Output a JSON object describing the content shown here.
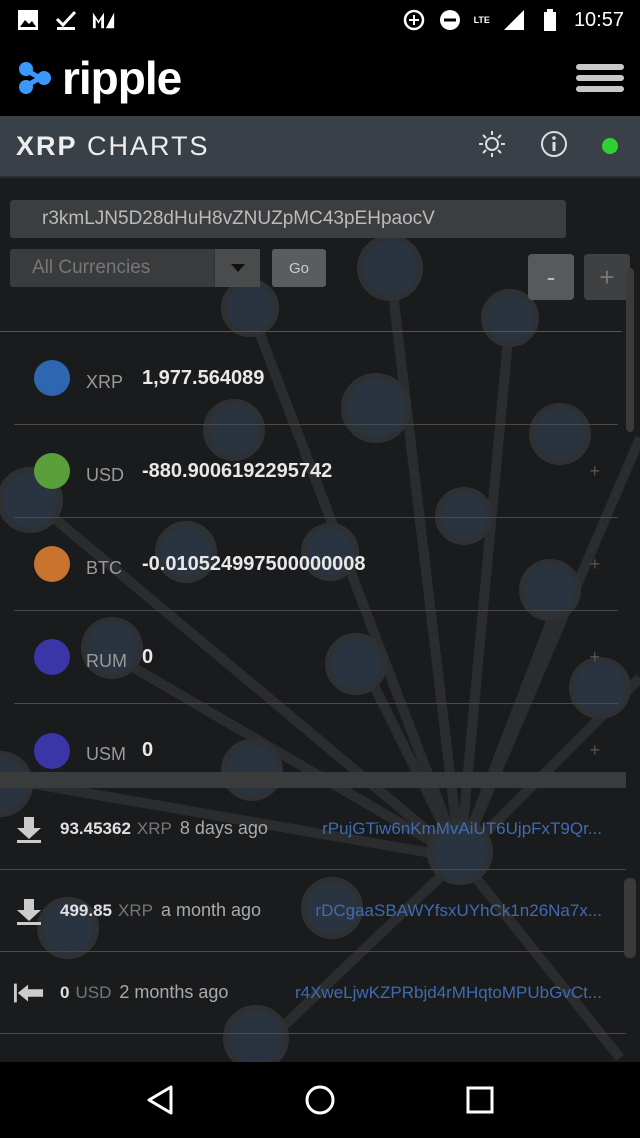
{
  "status_bar": {
    "time": "10:57",
    "network": "LTE",
    "icons": [
      "image-icon",
      "checkmark-icon",
      "m-logo-icon",
      "data-saver-icon",
      "do-not-disturb-icon",
      "signal-icon",
      "battery-icon"
    ]
  },
  "brand": {
    "logo_text": "ripple",
    "logo_color": "#3B99FC"
  },
  "charts_bar": {
    "title_bold": "XRP",
    "title_light": "CHARTS",
    "status_color": "#2FD02F"
  },
  "controls": {
    "address_value": "r3kmLJN5D28dHuH8vZNUZpMC43pEHpaocV",
    "currency_selected": "All Currencies",
    "go_label": "Go",
    "zoom_minus": "-",
    "zoom_plus": "+"
  },
  "balances": [
    {
      "currency": "XRP",
      "value": "1,977.564089",
      "color": "#2f66b0",
      "plus": ""
    },
    {
      "currency": "USD",
      "value": "-880.9006192295742",
      "color": "#5aa03a",
      "plus": "+"
    },
    {
      "currency": "BTC",
      "value": "-0.010524997500000008",
      "color": "#c8742e",
      "plus": "+"
    },
    {
      "currency": "RUM",
      "value": "0",
      "color": "#3a36a8",
      "plus": "+"
    },
    {
      "currency": "USM",
      "value": "0",
      "color": "#3a36a8",
      "plus": "+"
    }
  ],
  "transactions": [
    {
      "icon": "arrow-down-icon",
      "amount": "93.45362",
      "currency": "XRP",
      "when": "8 days ago",
      "address": "rPujGTiw6nKmMvAiUT6UjpFxT9Qr..."
    },
    {
      "icon": "arrow-down-icon",
      "amount": "499.85",
      "currency": "XRP",
      "when": "a month ago",
      "address": "rDCgaaSBAWYfsxUYhCk1n26Na7x..."
    },
    {
      "icon": "arrow-left-bar-icon",
      "amount": "0",
      "currency": "USD",
      "when": "2 months ago",
      "address": "r4XweLjwKZPRbjd4rMHqtoMPUbGvCt..."
    }
  ],
  "nav": [
    "back-icon",
    "home-icon",
    "recents-icon"
  ]
}
